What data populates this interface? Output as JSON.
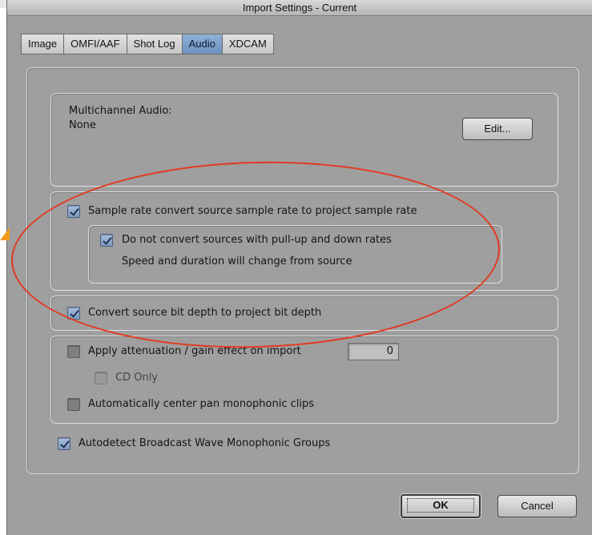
{
  "window": {
    "title": "Import Settings - Current"
  },
  "tabs": [
    {
      "label": "Image",
      "active": false
    },
    {
      "label": "OMFI/AAF",
      "active": false
    },
    {
      "label": "Shot Log",
      "active": false
    },
    {
      "label": "Audio",
      "active": true
    },
    {
      "label": "XDCAM",
      "active": false
    }
  ],
  "multichannel": {
    "label": "Multichannel Audio:",
    "value": "None",
    "edit_button": "Edit..."
  },
  "options": {
    "sample_rate_convert": {
      "label": "Sample rate convert source sample rate to project sample rate",
      "checked": true
    },
    "no_convert_pullup": {
      "label": "Do not convert sources with pull-up and down rates",
      "checked": true,
      "note": "Speed and duration will change from source"
    },
    "bit_depth": {
      "label": "Convert source bit depth to project bit depth",
      "checked": true
    },
    "attenuation": {
      "label": "Apply attenuation / gain effect on import",
      "checked": false,
      "value": "0"
    },
    "cd_only": {
      "label": "CD Only",
      "checked": false,
      "disabled": true
    },
    "center_pan": {
      "label": "Automatically center pan monophonic clips",
      "checked": false
    },
    "autodetect_bwf": {
      "label": "Autodetect Broadcast Wave Monophonic Groups",
      "checked": true
    }
  },
  "footer": {
    "ok_label": "OK",
    "cancel_label": "Cancel"
  },
  "colors": {
    "annotation_ellipse": "#e2391f",
    "annotation_arrow": "#f19a1f",
    "active_tab": "#7a9cc8",
    "window_bg": "#9f9f9f"
  }
}
